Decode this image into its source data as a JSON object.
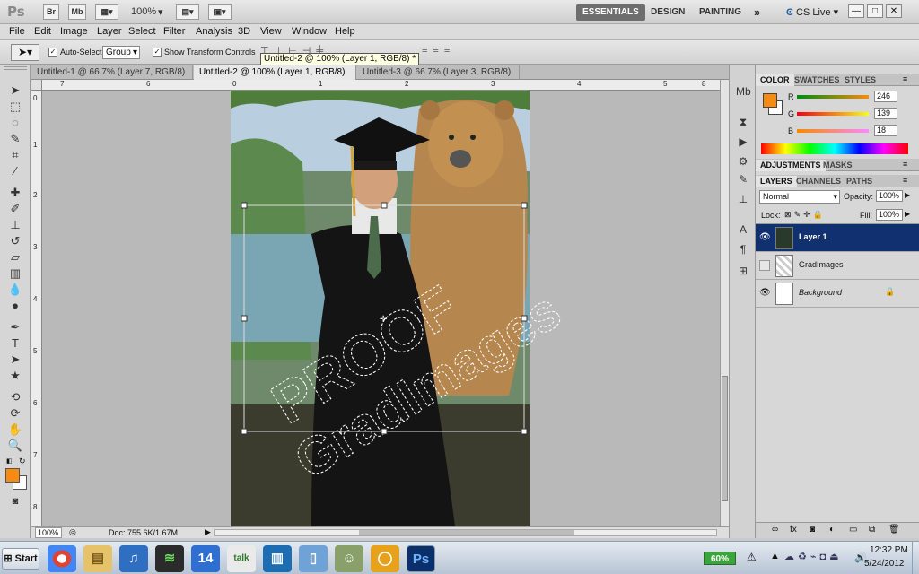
{
  "titlebar": {
    "app_logo": "Ps",
    "btn_br": "Br",
    "btn_mb": "Mb",
    "zoom": "100%",
    "workspaces": [
      "ESSENTIALS",
      "DESIGN",
      "PAINTING"
    ],
    "more": "»",
    "cs_live": "CS Live",
    "win_min": "—",
    "win_max": "□",
    "win_close": "✕"
  },
  "menu": [
    "File",
    "Edit",
    "Image",
    "Layer",
    "Select",
    "Filter",
    "Analysis",
    "3D",
    "View",
    "Window",
    "Help"
  ],
  "options": {
    "auto_select_label": "Auto-Select:",
    "auto_select_value": "Group",
    "show_transform_label": "Show Transform Controls",
    "tooltip": "Untitled-2 @ 100% (Layer 1, RGB/8) *"
  },
  "tabs": [
    {
      "label": "Untitled-1 @ 66.7% (Layer 7, RGB/8) *",
      "active": false
    },
    {
      "label": "Untitled-2 @ 100% (Layer 1, RGB/8) *",
      "active": true
    },
    {
      "label": "Untitled-3 @ 66.7% (Layer 3, RGB/8) *",
      "active": false
    }
  ],
  "ruler_h": [
    "0",
    "1",
    "2",
    "3",
    "4",
    "5",
    "6",
    "7",
    "8"
  ],
  "ruler_v": [
    "0",
    "1",
    "2",
    "3",
    "4",
    "5",
    "6",
    "7",
    "8",
    "9"
  ],
  "watermark": {
    "line1": "PROOF",
    "line2": "GradImages"
  },
  "status": {
    "zoom": "100%",
    "doc": "Doc: 755.6K/1.67M"
  },
  "color_panel": {
    "tabs": [
      "COLOR",
      "SWATCHES",
      "STYLES"
    ],
    "r_label": "R",
    "r_value": "246",
    "g_label": "G",
    "g_value": "139",
    "b_label": "B",
    "b_value": "18",
    "fg_color": "#f68b12"
  },
  "adjust_tabs": [
    "ADJUSTMENTS",
    "MASKS"
  ],
  "layers_panel": {
    "tabs": [
      "LAYERS",
      "CHANNELS",
      "PATHS"
    ],
    "blend_mode": "Normal",
    "opacity_label": "Opacity:",
    "opacity": "100%",
    "lock_label": "Lock:",
    "fill_label": "Fill:",
    "fill": "100%",
    "layers": [
      {
        "name": "Layer 1",
        "selected": true,
        "visible": true
      },
      {
        "name": "GradImages",
        "selected": false,
        "visible": false
      },
      {
        "name": "Background",
        "selected": false,
        "visible": true
      }
    ]
  },
  "taskbar": {
    "start": "Start",
    "calendar_icon_text": "14",
    "talk_icon_text": "talk",
    "ps_icon_text": "Ps",
    "battery": "60%",
    "time": "12:32 PM",
    "date": "5/24/2012"
  }
}
